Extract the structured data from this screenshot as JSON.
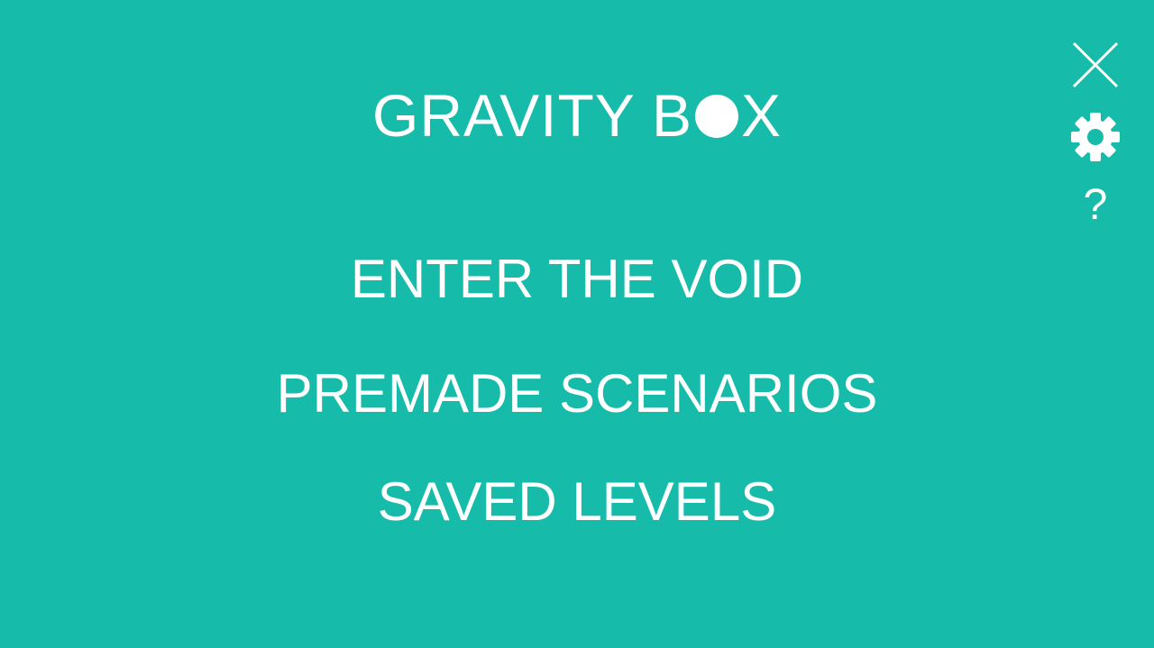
{
  "app": {
    "title_part1": "GRAVITY B",
    "title_part2": "X"
  },
  "menu": [
    {
      "label": "ENTER THE VOID"
    },
    {
      "label": "PREMADE SCENARIOS"
    },
    {
      "label": "SAVED LEVELS"
    }
  ],
  "icons": {
    "close": "close-icon",
    "settings": "gear-icon",
    "help": "?"
  },
  "colors": {
    "background": "#16bca9",
    "foreground": "#ffffff"
  }
}
